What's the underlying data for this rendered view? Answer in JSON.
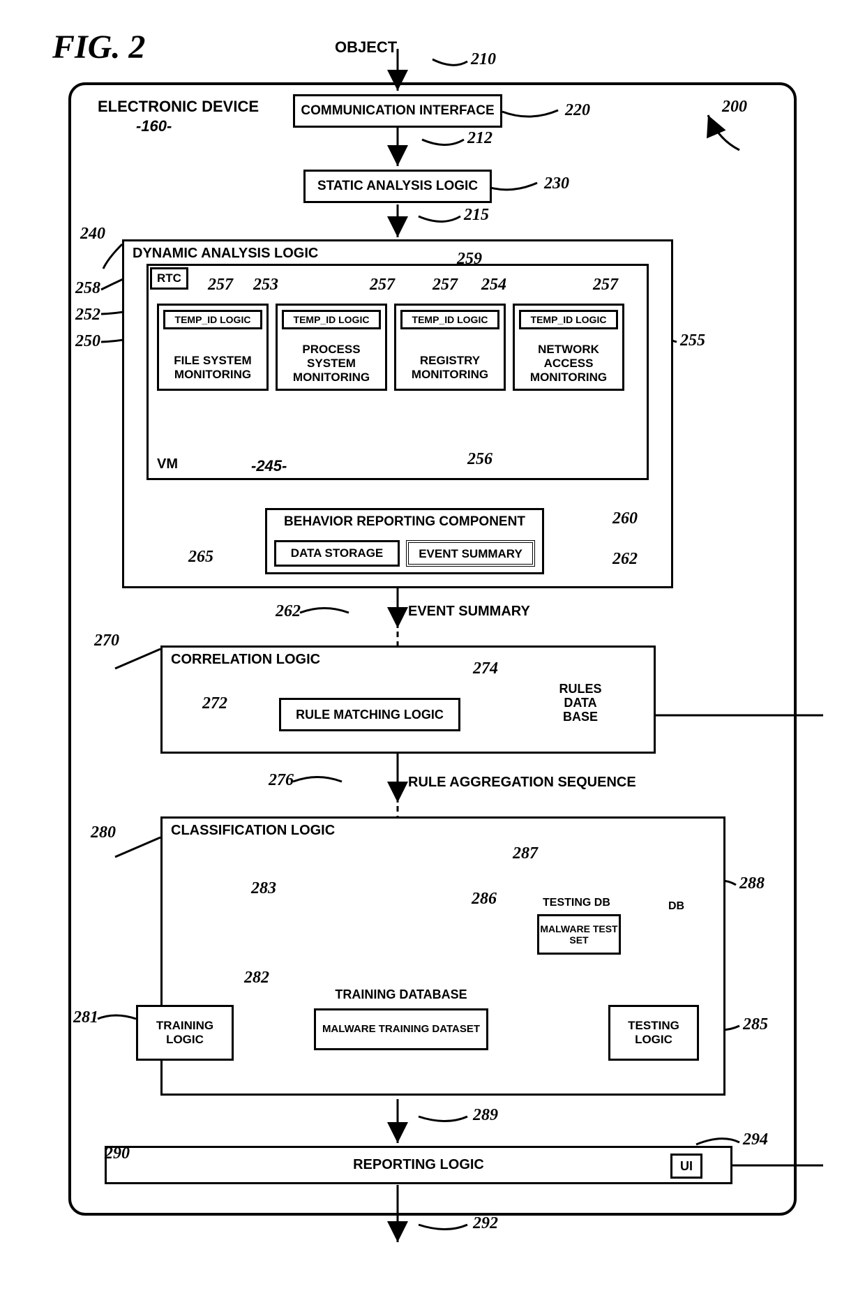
{
  "fig": "FIG. 2",
  "object": "OBJECT",
  "electronic_device": "ELECTRONIC DEVICE",
  "ed_num": "-160-",
  "comm_interface": "COMMUNICATION INTERFACE",
  "static_analysis": "STATIC ANALYSIS LOGIC",
  "dynamic_analysis": "DYNAMIC ANALYSIS LOGIC",
  "rtc": "RTC",
  "temp_id": "TEMP_ID LOGIC",
  "file_mon": "FILE SYSTEM MONITORING",
  "proc_mon": "PROCESS SYSTEM MONITORING",
  "reg_mon": "REGISTRY MONITORING",
  "net_mon": "NETWORK ACCESS MONITORING",
  "vm": "VM",
  "vm_num": "-245-",
  "brc": "BEHAVIOR REPORTING COMPONENT",
  "data_storage": "DATA STORAGE",
  "event_summary": "EVENT SUMMARY",
  "event_summary_lbl": "EVENT SUMMARY",
  "correlation": "CORRELATION LOGIC",
  "rule_matching": "RULE MATCHING LOGIC",
  "rules_db": "RULES DATA BASE",
  "rule_agg": "RULE AGGREGATION SEQUENCE",
  "classification": "CLASSIFICATION LOGIC",
  "training_logic": "TRAINING LOGIC",
  "training_db": "TRAINING DATABASE",
  "malware_training": "MALWARE TRAINING DATASET",
  "testing_db": "TESTING DB",
  "malware_test": "MALWARE TEST SET",
  "db": "DB",
  "testing_logic": "TESTING LOGIC",
  "reporting_logic": "REPORTING LOGIC",
  "ui": "UI",
  "refs": {
    "r200": "200",
    "r210": "210",
    "r212": "212",
    "r215": "215",
    "r220": "220",
    "r230": "230",
    "r240": "240",
    "r250": "250",
    "r252": "252",
    "r253": "253",
    "r254": "254",
    "r255": "255",
    "r256": "256",
    "r257a": "257",
    "r257b": "257",
    "r257c": "257",
    "r257d": "257",
    "r258": "258",
    "r259": "259",
    "r260": "260",
    "r262a": "262",
    "r262b": "262",
    "r265": "265",
    "r270": "270",
    "r272": "272",
    "r274": "274",
    "r276": "276",
    "r280": "280",
    "r281": "281",
    "r282": "282",
    "r283": "283",
    "r285": "285",
    "r286": "286",
    "r287": "287",
    "r288": "288",
    "r289": "289",
    "r290": "290",
    "r292": "292",
    "r294": "294"
  }
}
